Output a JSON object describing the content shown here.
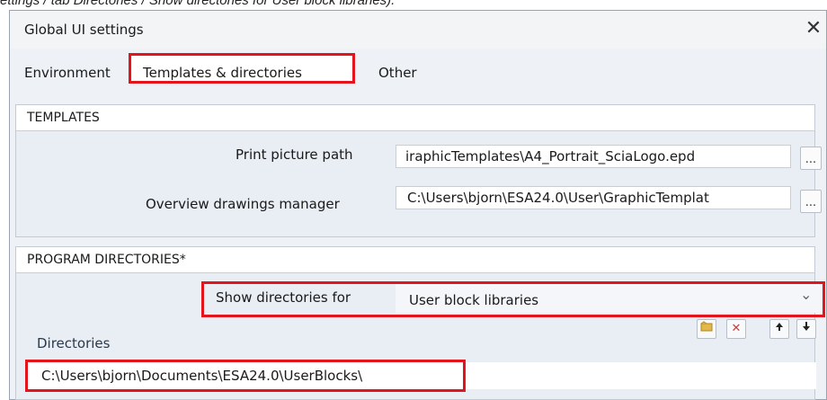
{
  "caption": "ettings / tab Directories / Show directories for User block libraries).",
  "dialog": {
    "title": "Global UI settings",
    "close_glyph": "✕"
  },
  "tabs": [
    {
      "label": "Environment",
      "active": false
    },
    {
      "label": "Templates & directories",
      "active": true
    },
    {
      "label": "Other",
      "active": false
    }
  ],
  "templates": {
    "header": "TEMPLATES",
    "rows": [
      {
        "label": "Print picture path",
        "value": "iraphicTemplates\\A4_Portrait_SciaLogo.epd",
        "button": "..."
      },
      {
        "label": "Overview drawings manager",
        "value": "C:\\Users\\bjorn\\ESA24.0\\User\\GraphicTemplat",
        "button": "..."
      }
    ]
  },
  "program_directories": {
    "header": "PROGRAM DIRECTORIES*",
    "show_label": "Show directories for",
    "show_value": "User block libraries",
    "dropdown_glyph": "⌄",
    "directories_label": "Directories",
    "toolbar_icons": [
      "new-folder-icon",
      "delete-icon",
      "arrow-up-icon",
      "arrow-down-icon"
    ],
    "delete_color": "#d03a3a",
    "directory_entries": [
      "C:\\Users\\bjorn\\Documents\\ESA24.0\\UserBlocks\\"
    ]
  },
  "colors": {
    "highlight": "#e3141b",
    "panel": "#eef1f6"
  }
}
